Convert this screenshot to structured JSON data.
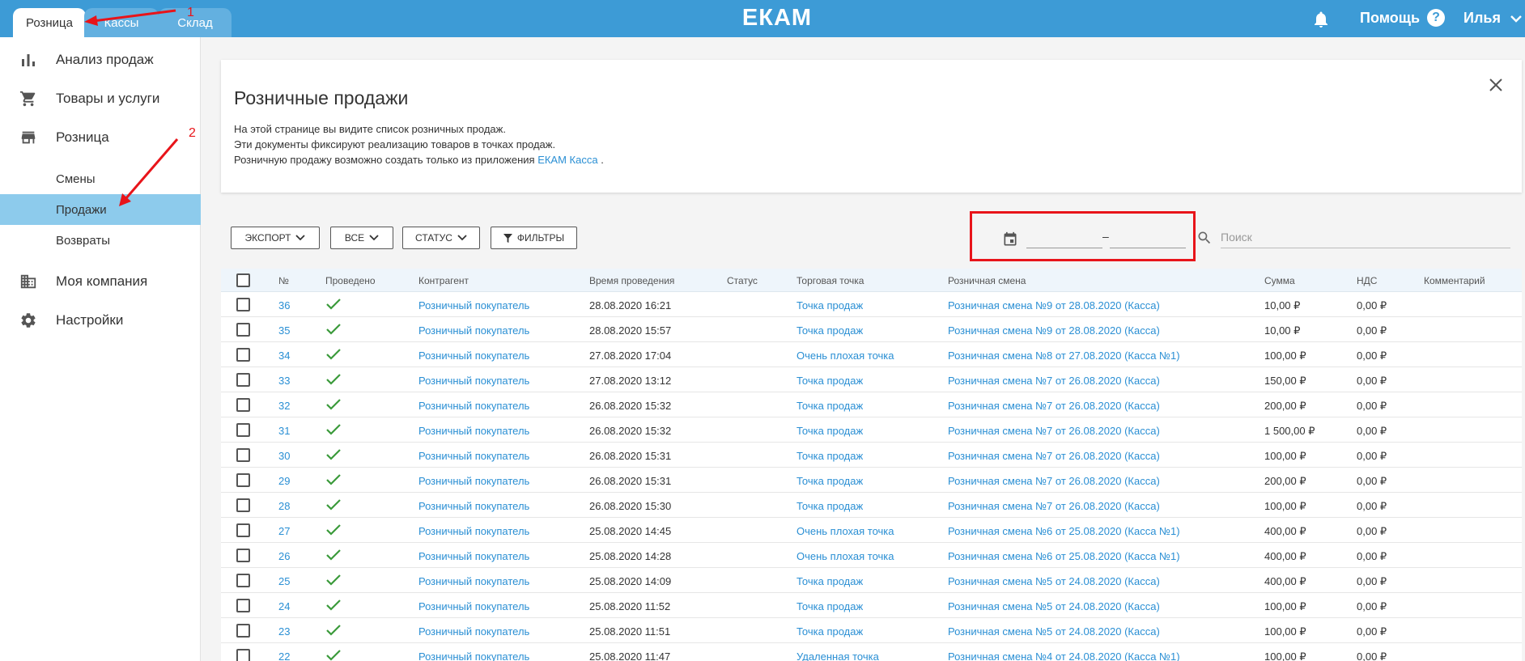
{
  "top_tabs": [
    {
      "label": "Розница",
      "active": true
    },
    {
      "label": "Кассы",
      "active": false
    },
    {
      "label": "Склад",
      "active": false
    }
  ],
  "logo": "ЕКАМ",
  "header": {
    "help_label": "Помощь",
    "help_icon": "?",
    "user_name": "Илья"
  },
  "sidebar": {
    "items": [
      {
        "label": "Анализ продаж",
        "icon": "bar-chart-icon"
      },
      {
        "label": "Товары и услуги",
        "icon": "cart-icon"
      },
      {
        "label": "Розница",
        "icon": "store-icon"
      },
      {
        "label": "Моя компания",
        "icon": "building-icon"
      },
      {
        "label": "Настройки",
        "icon": "gear-icon"
      }
    ],
    "subitems": [
      {
        "label": "Смены",
        "selected": false
      },
      {
        "label": "Продажи",
        "selected": true
      },
      {
        "label": "Возвраты",
        "selected": false
      }
    ]
  },
  "info": {
    "title": "Розничные продажи",
    "line1": "На этой странице вы видите список розничных продаж.",
    "line2": "Эти документы фиксируют реализацию товаров в точках продаж.",
    "line3_prefix": "Розничную продажу возможно создать только из приложения ",
    "line3_link": "ЕКАМ Касса",
    "line3_suffix": " ."
  },
  "toolbar": {
    "export_label": "ЭКСПОРТ",
    "all_label": "ВСЕ",
    "status_label": "СТАТУС",
    "filters_label": "ФИЛЬТРЫ",
    "date_from": "",
    "date_to": "",
    "date_separator": "–",
    "search_placeholder": "Поиск"
  },
  "table": {
    "columns": [
      "№",
      "Проведено",
      "Контрагент",
      "Время проведения",
      "Статус",
      "Торговая точка",
      "Розничная смена",
      "Сумма",
      "НДС",
      "Комментарий"
    ],
    "rows": [
      {
        "num": "36",
        "counterparty": "Розничный покупатель",
        "time": "28.08.2020 16:21",
        "status": "",
        "store": "Точка продаж",
        "shift": "Розничная смена №9 от 28.08.2020 (Касса)",
        "sum": "10,00 ₽",
        "vat": "0,00 ₽",
        "comment": ""
      },
      {
        "num": "35",
        "counterparty": "Розничный покупатель",
        "time": "28.08.2020 15:57",
        "status": "",
        "store": "Точка продаж",
        "shift": "Розничная смена №9 от 28.08.2020 (Касса)",
        "sum": "10,00 ₽",
        "vat": "0,00 ₽",
        "comment": ""
      },
      {
        "num": "34",
        "counterparty": "Розничный покупатель",
        "time": "27.08.2020 17:04",
        "status": "",
        "store": "Очень плохая точка",
        "shift": "Розничная смена №8 от 27.08.2020 (Касса №1)",
        "sum": "100,00 ₽",
        "vat": "0,00 ₽",
        "comment": ""
      },
      {
        "num": "33",
        "counterparty": "Розничный покупатель",
        "time": "27.08.2020 13:12",
        "status": "",
        "store": "Точка продаж",
        "shift": "Розничная смена №7 от 26.08.2020 (Касса)",
        "sum": "150,00 ₽",
        "vat": "0,00 ₽",
        "comment": ""
      },
      {
        "num": "32",
        "counterparty": "Розничный покупатель",
        "time": "26.08.2020 15:32",
        "status": "",
        "store": "Точка продаж",
        "shift": "Розничная смена №7 от 26.08.2020 (Касса)",
        "sum": "200,00 ₽",
        "vat": "0,00 ₽",
        "comment": ""
      },
      {
        "num": "31",
        "counterparty": "Розничный покупатель",
        "time": "26.08.2020 15:32",
        "status": "",
        "store": "Точка продаж",
        "shift": "Розничная смена №7 от 26.08.2020 (Касса)",
        "sum": "1 500,00 ₽",
        "vat": "0,00 ₽",
        "comment": ""
      },
      {
        "num": "30",
        "counterparty": "Розничный покупатель",
        "time": "26.08.2020 15:31",
        "status": "",
        "store": "Точка продаж",
        "shift": "Розничная смена №7 от 26.08.2020 (Касса)",
        "sum": "100,00 ₽",
        "vat": "0,00 ₽",
        "comment": ""
      },
      {
        "num": "29",
        "counterparty": "Розничный покупатель",
        "time": "26.08.2020 15:31",
        "status": "",
        "store": "Точка продаж",
        "shift": "Розничная смена №7 от 26.08.2020 (Касса)",
        "sum": "200,00 ₽",
        "vat": "0,00 ₽",
        "comment": ""
      },
      {
        "num": "28",
        "counterparty": "Розничный покупатель",
        "time": "26.08.2020 15:30",
        "status": "",
        "store": "Точка продаж",
        "shift": "Розничная смена №7 от 26.08.2020 (Касса)",
        "sum": "100,00 ₽",
        "vat": "0,00 ₽",
        "comment": ""
      },
      {
        "num": "27",
        "counterparty": "Розничный покупатель",
        "time": "25.08.2020 14:45",
        "status": "",
        "store": "Очень плохая точка",
        "shift": "Розничная смена №6 от 25.08.2020 (Касса №1)",
        "sum": "400,00 ₽",
        "vat": "0,00 ₽",
        "comment": ""
      },
      {
        "num": "26",
        "counterparty": "Розничный покупатель",
        "time": "25.08.2020 14:28",
        "status": "",
        "store": "Очень плохая точка",
        "shift": "Розничная смена №6 от 25.08.2020 (Касса №1)",
        "sum": "400,00 ₽",
        "vat": "0,00 ₽",
        "comment": ""
      },
      {
        "num": "25",
        "counterparty": "Розничный покупатель",
        "time": "25.08.2020 14:09",
        "status": "",
        "store": "Точка продаж",
        "shift": "Розничная смена №5 от 24.08.2020 (Касса)",
        "sum": "400,00 ₽",
        "vat": "0,00 ₽",
        "comment": ""
      },
      {
        "num": "24",
        "counterparty": "Розничный покупатель",
        "time": "25.08.2020 11:52",
        "status": "",
        "store": "Точка продаж",
        "shift": "Розничная смена №5 от 24.08.2020 (Касса)",
        "sum": "100,00 ₽",
        "vat": "0,00 ₽",
        "comment": ""
      },
      {
        "num": "23",
        "counterparty": "Розничный покупатель",
        "time": "25.08.2020 11:51",
        "status": "",
        "store": "Точка продаж",
        "shift": "Розничная смена №5 от 24.08.2020 (Касса)",
        "sum": "100,00 ₽",
        "vat": "0,00 ₽",
        "comment": ""
      },
      {
        "num": "22",
        "counterparty": "Розничный покупатель",
        "time": "25.08.2020 11:47",
        "status": "",
        "store": "Удаленная точка",
        "shift": "Розничная смена №4 от 24.08.2020 (Касса №1)",
        "sum": "100,00 ₽",
        "vat": "0,00 ₽",
        "comment": ""
      }
    ]
  },
  "annotations": {
    "step1": "1",
    "step2": "2"
  },
  "colors": {
    "brand": "#3d9bd6",
    "link": "#2a8fd4",
    "selected": "#8dcbec",
    "check": "#3a9a3a",
    "annotation": "#e8141a"
  }
}
